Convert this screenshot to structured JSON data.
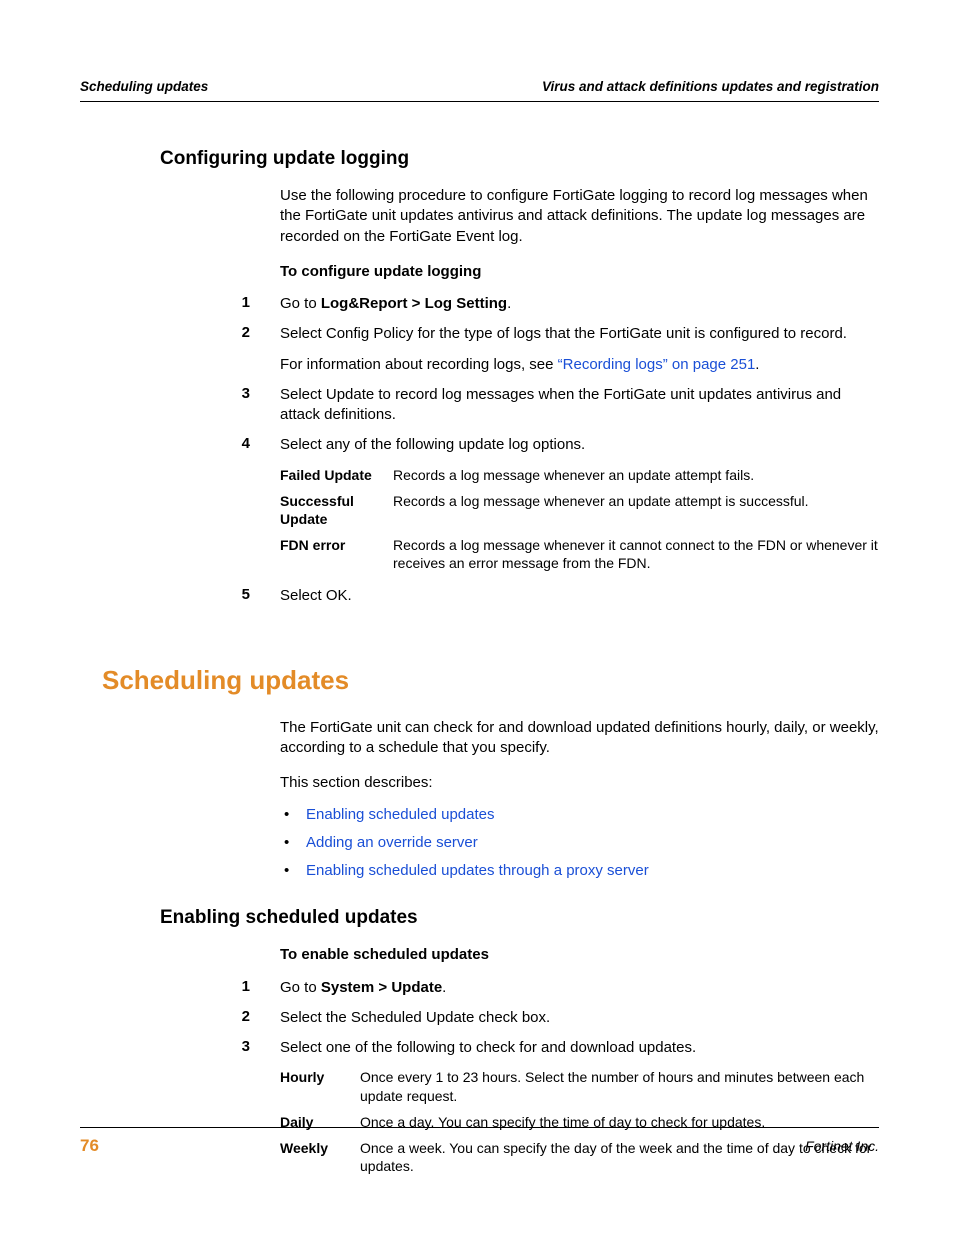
{
  "header": {
    "left": "Scheduling updates",
    "right": "Virus and attack definitions updates and registration"
  },
  "sec1": {
    "title": "Configuring update logging",
    "intro": "Use the following procedure to configure FortiGate logging to record log messages when the FortiGate unit updates antivirus and attack definitions. The update log messages are recorded on the FortiGate Event log.",
    "procTitle": "To configure update logging",
    "step1_pre": "Go to ",
    "step1_b": "Log&Report > Log Setting",
    "step1_post": ".",
    "step2a": "Select Config Policy for the type of logs that the FortiGate unit is configured to record.",
    "step2b_pre": "For information about recording logs, see ",
    "step2b_link": "“Recording logs” on page 251",
    "step2b_post": ".",
    "step3": "Select Update to record log messages when the FortiGate unit updates antivirus and attack definitions.",
    "step4": "Select any of the following update log options.",
    "table": [
      {
        "term": "Failed Update",
        "desc": "Records a log message whenever an update attempt fails."
      },
      {
        "term": "Successful Update",
        "desc": "Records a log message whenever an update attempt is successful."
      },
      {
        "term": "FDN error",
        "desc": "Records a log message whenever it cannot connect to the FDN or whenever it receives an error message from the FDN."
      }
    ],
    "step5": "Select OK."
  },
  "sec2": {
    "title": "Scheduling updates",
    "intro": "The FortiGate unit can check for and download updated definitions hourly, daily, or weekly, according to a schedule that you specify.",
    "desc": "This section describes:",
    "links": [
      "Enabling scheduled updates",
      "Adding an override server",
      "Enabling scheduled updates through a proxy server"
    ]
  },
  "sec3": {
    "title": "Enabling scheduled updates",
    "procTitle": "To enable scheduled updates",
    "step1_pre": "Go to ",
    "step1_b": "System > Update",
    "step1_post": ".",
    "step2": "Select the Scheduled Update check box.",
    "step3": "Select one of the following to check for and download updates.",
    "table": [
      {
        "term": "Hourly",
        "desc": "Once every 1 to 23 hours. Select the number of hours and minutes between each update request."
      },
      {
        "term": "Daily",
        "desc": "Once a day. You can specify the time of day to check for updates."
      },
      {
        "term": "Weekly",
        "desc": "Once a week. You can specify the day of the week and the time of day to check for updates."
      }
    ]
  },
  "nums": {
    "n1": "1",
    "n2": "2",
    "n3": "3",
    "n4": "4",
    "n5": "5"
  },
  "bulletDot": "•",
  "footer": {
    "page": "76",
    "publisher": "Fortinet Inc."
  }
}
